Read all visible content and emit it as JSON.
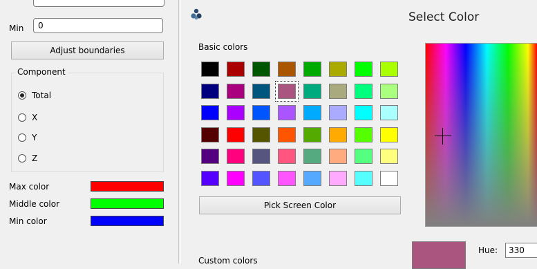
{
  "left": {
    "min_label": "Min",
    "min_value": "0",
    "adjust_label": "Adjust boundaries",
    "component_title": "Component",
    "component_options": [
      "Total",
      "X",
      "Y",
      "Z"
    ],
    "component_selected": "Total",
    "max_color_label": "Max color",
    "middle_color_label": "Middle color",
    "min_color_label": "Min color",
    "max_color": "#ff0000",
    "middle_color": "#00ff00",
    "min_color": "#0000ff"
  },
  "dialog": {
    "title": "Select Color",
    "basic_colors_label": "Basic colors",
    "pick_screen_label": "Pick Screen Color",
    "custom_colors_label": "Custom colors",
    "hue_label": "Hue:",
    "hue_value": "330",
    "current_color": "#aa557f",
    "selected_index": 11,
    "basic_colors": [
      "#000000",
      "#aa0000",
      "#005500",
      "#aa5500",
      "#00aa00",
      "#aaaa00",
      "#00ff00",
      "#aaff00",
      "#00007f",
      "#aa007f",
      "#00557f",
      "#aa557f",
      "#00aa7f",
      "#aaaa7f",
      "#00ff7f",
      "#aaff7f",
      "#0000ff",
      "#aa00ff",
      "#0055ff",
      "#aa55ff",
      "#00aaff",
      "#aaaaff",
      "#00ffff",
      "#aaffff",
      "#550000",
      "#ff0000",
      "#555500",
      "#ff5500",
      "#55aa00",
      "#ffaa00",
      "#55ff00",
      "#ffff00",
      "#55007f",
      "#ff007f",
      "#55557f",
      "#ff557f",
      "#55aa7f",
      "#ffaa7f",
      "#55ff7f",
      "#ffff7f",
      "#5500ff",
      "#ff00ff",
      "#5555ff",
      "#ff55ff",
      "#55aaff",
      "#ffaaff",
      "#55ffff",
      "#ffffff"
    ]
  }
}
